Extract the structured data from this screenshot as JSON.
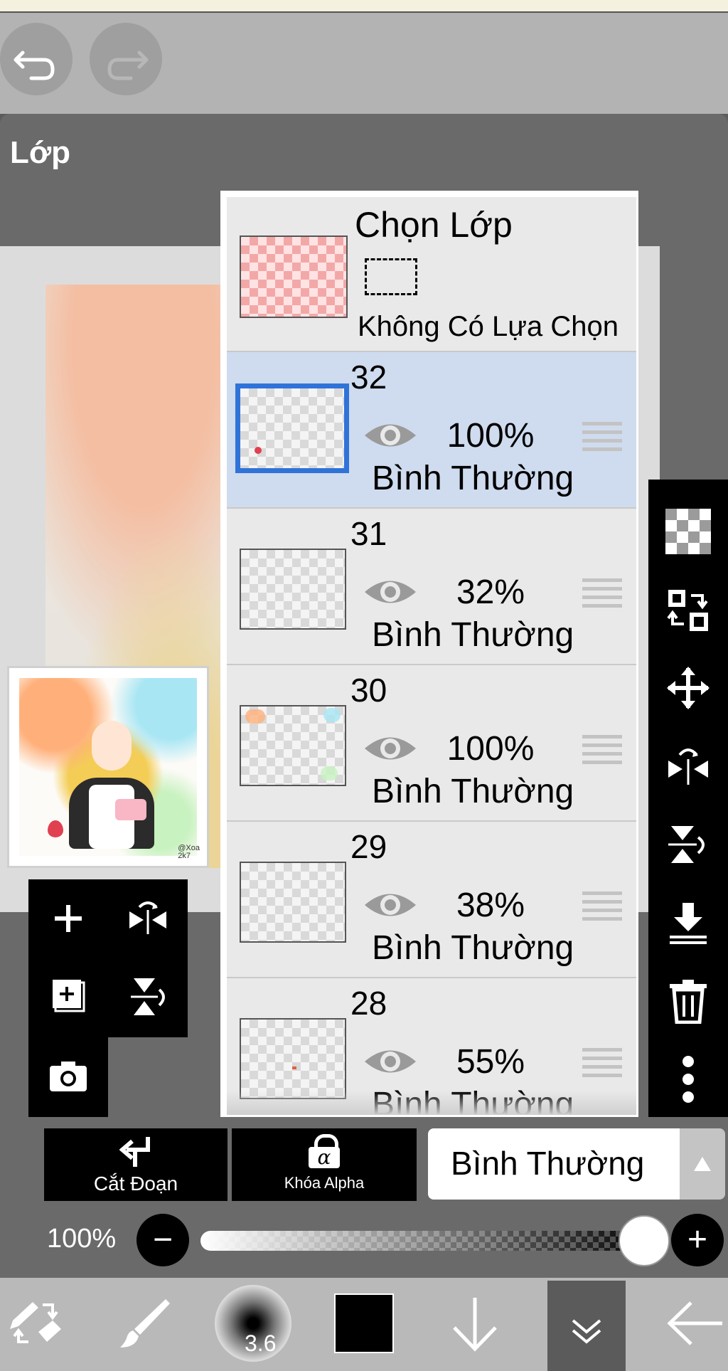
{
  "panel": {
    "title": "Lớp"
  },
  "selection_row": {
    "title": "Chọn Lớp",
    "subtitle": "Không Có Lựa Chọn"
  },
  "layers": [
    {
      "name": "32",
      "opacity": "100%",
      "mode": "Bình Thường",
      "selected": true
    },
    {
      "name": "31",
      "opacity": "32%",
      "mode": "Bình Thường",
      "selected": false
    },
    {
      "name": "30",
      "opacity": "100%",
      "mode": "Bình Thường",
      "selected": false
    },
    {
      "name": "29",
      "opacity": "38%",
      "mode": "Bình Thường",
      "selected": false
    },
    {
      "name": "28",
      "opacity": "55%",
      "mode": "Bình Thường",
      "selected": false
    }
  ],
  "bottom_controls": {
    "clip_label": "Cắt Đoạn",
    "alpha_lock_label": "Khóa Alpha",
    "alpha_lock_glyph": "α",
    "blend_mode": "Bình Thường",
    "opacity_label": "100%",
    "opacity_value": 1.0,
    "minus": "−",
    "plus": "+"
  },
  "toolbar": {
    "brush_size": "3.6",
    "color": "#000000"
  },
  "preview": {
    "signature": "@Xoa\n2k7"
  },
  "colors": {
    "selection_highlight": "#cfdbee",
    "selected_border": "#2f73d9",
    "panel": "#6a6a6a"
  },
  "icons": {
    "top": [
      "undo-icon",
      "redo-icon"
    ],
    "left": [
      "add-layer-icon",
      "flip-horizontal-icon",
      "copy-layer-icon",
      "flip-vertical-icon",
      "camera-icon"
    ],
    "right": [
      "transparency-icon",
      "swap-layer-icon",
      "move-icon",
      "flip-horizontal-icon",
      "flip-vertical-icon",
      "merge-down-icon",
      "trash-icon",
      "more-icon"
    ],
    "bottom": [
      "tool-swap-icon",
      "brush-icon",
      "brush-size-icon",
      "color-swatch",
      "arrow-down-icon",
      "chevron-double-down-icon",
      "back-arrow-icon"
    ]
  }
}
